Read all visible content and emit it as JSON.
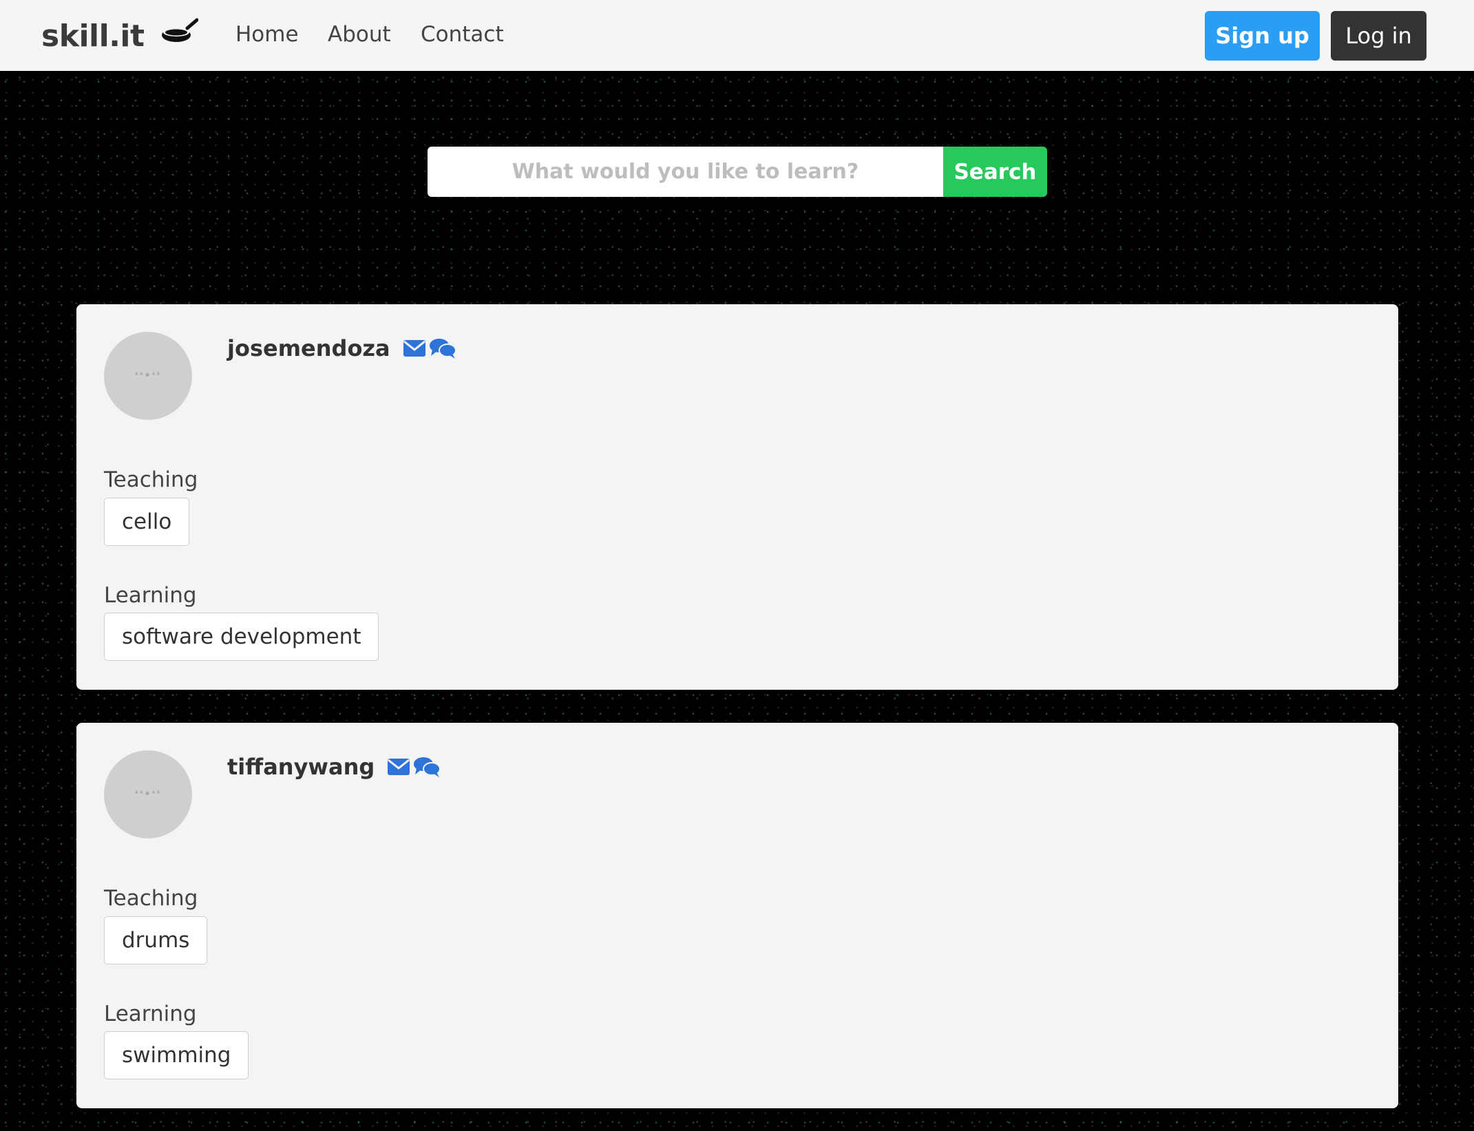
{
  "navbar": {
    "brand": "skill.it",
    "brand_icon": "frying-pan-icon",
    "links": [
      {
        "label": "Home"
      },
      {
        "label": "About"
      },
      {
        "label": "Contact"
      }
    ],
    "signup_label": "Sign up",
    "login_label": "Log in",
    "colors": {
      "signup": "#2a9df4",
      "login": "#333333"
    }
  },
  "search": {
    "placeholder": "What would you like to learn?",
    "value": "",
    "button_label": "Search",
    "button_color": "#27c95c"
  },
  "users": [
    {
      "username": "josemendoza",
      "icons": [
        "envelope-icon",
        "chat-bubbles-icon"
      ],
      "teaching_label": "Teaching",
      "teaching": [
        "cello"
      ],
      "learning_label": "Learning",
      "learning": [
        "software development"
      ]
    },
    {
      "username": "tiffanywang",
      "icons": [
        "envelope-icon",
        "chat-bubbles-icon"
      ],
      "teaching_label": "Teaching",
      "teaching": [
        "drums"
      ],
      "learning_label": "Learning",
      "learning": [
        "swimming"
      ]
    }
  ]
}
